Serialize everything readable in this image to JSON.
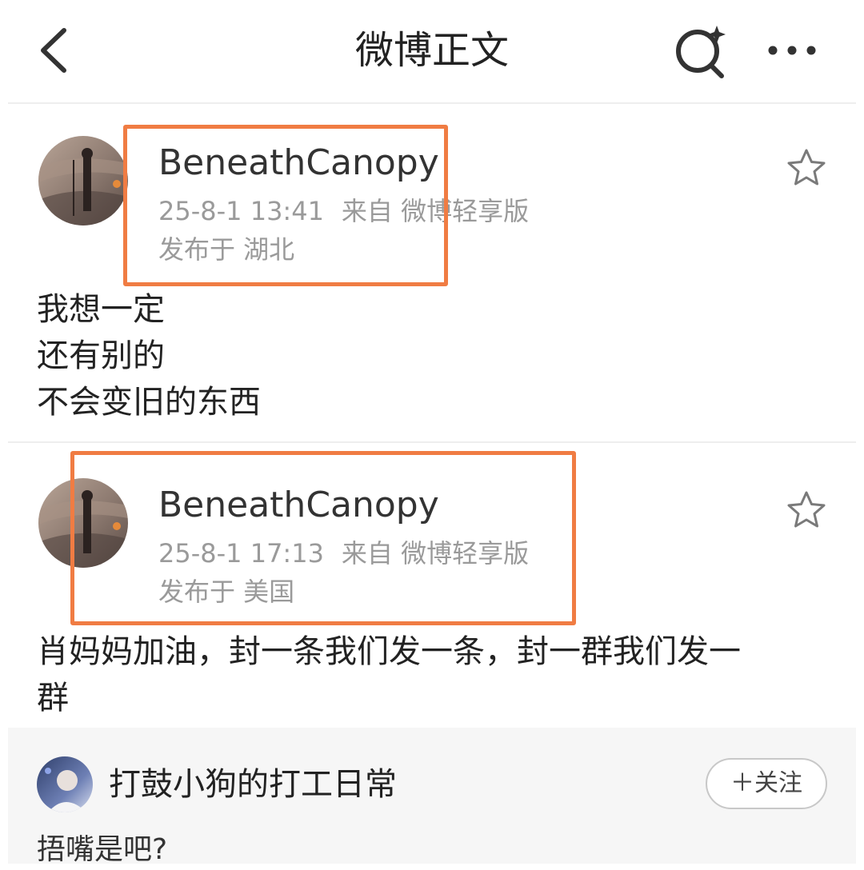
{
  "header": {
    "title": "微博正文",
    "back_icon": "chevron-left-icon",
    "search_icon": "search-sparkle-icon",
    "more_icon": "more-dots-icon"
  },
  "posts": [
    {
      "username": "BeneathCanopy",
      "time": "25-8-1 13:41",
      "source": "来自 微博轻享版",
      "location": "发布于 湖北",
      "text_lines": [
        "我想一定",
        "还有别的",
        "不会变旧的东西"
      ]
    },
    {
      "username": "BeneathCanopy",
      "time": "25-8-1 17:13",
      "source": "来自 微博轻享版",
      "location": "发布于 美国",
      "text_lines": [
        "肖妈妈加油，封一条我们发一条，封一群我们发一",
        "群"
      ]
    }
  ],
  "card": {
    "name": "打鼓小狗的打工日常",
    "follow_label": "＋关注",
    "preview": "捂嘴是吧?"
  },
  "colors": {
    "highlight": "#f07c43",
    "meta_text": "#9a9a9a",
    "card_bg": "#f6f6f6"
  }
}
